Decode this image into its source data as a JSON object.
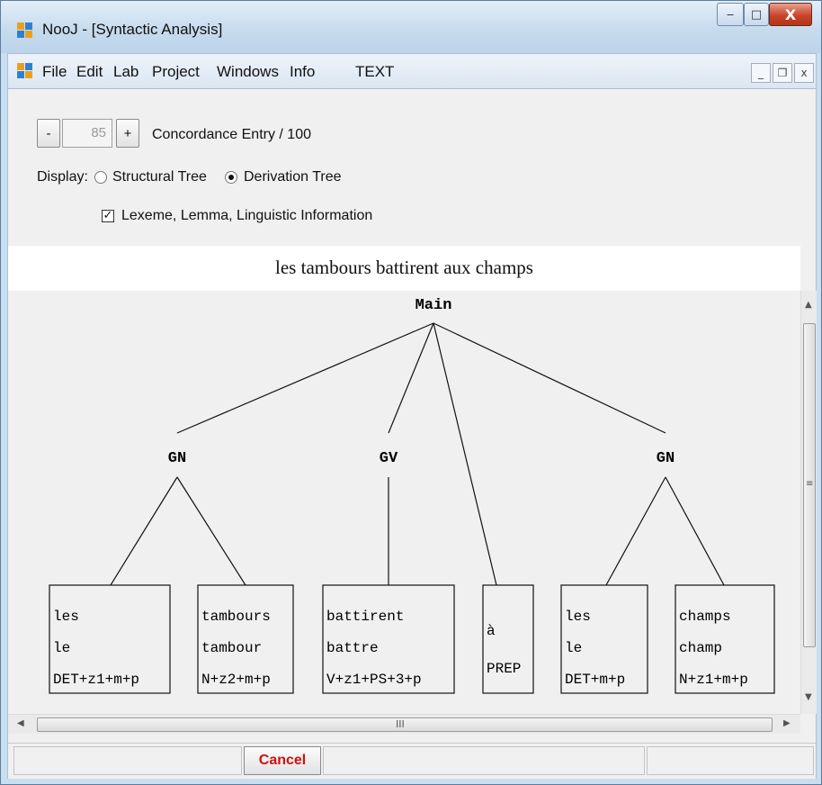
{
  "window": {
    "title": "NooJ - [Syntactic Analysis]",
    "minimize_label": "‒",
    "restore_label": "□",
    "close_label": "X"
  },
  "menu": {
    "items": [
      "File",
      "Edit",
      "Lab",
      "Project",
      "Windows",
      "Info",
      "TEXT"
    ],
    "mdi_minimize": "_",
    "mdi_restore": "❐",
    "mdi_close": "x"
  },
  "controls": {
    "minus_label": "-",
    "entry_value": "85",
    "plus_label": "+",
    "entry_caption": "Concordance Entry / 100",
    "display_label": "Display:",
    "radio_structural": "Structural Tree",
    "radio_derivation": "Derivation Tree",
    "selected_display": "Derivation Tree",
    "checkbox_label": "Lexeme, Lemma, Linguistic Information",
    "checkbox_checked": true
  },
  "sentence": "les tambours battirent aux champs",
  "tree": {
    "root": "Main",
    "phrases": [
      "GN",
      "GV",
      "GN"
    ],
    "leaves": [
      {
        "lexeme": "les",
        "lemma": "le",
        "info": "DET+z1+m+p"
      },
      {
        "lexeme": "tambours",
        "lemma": "tambour",
        "info": "N+z2+m+p"
      },
      {
        "lexeme": "battirent",
        "lemma": "battre",
        "info": "V+z1+PS+3+p"
      },
      {
        "lexeme": "à",
        "lemma": "",
        "info": "PREP"
      },
      {
        "lexeme": "les",
        "lemma": "le",
        "info": "DET+m+p"
      },
      {
        "lexeme": "champs",
        "lemma": "champ",
        "info": "N+z1+m+p"
      }
    ]
  },
  "scrollbar": {
    "grip": "III"
  },
  "footer": {
    "cancel_label": "Cancel"
  }
}
